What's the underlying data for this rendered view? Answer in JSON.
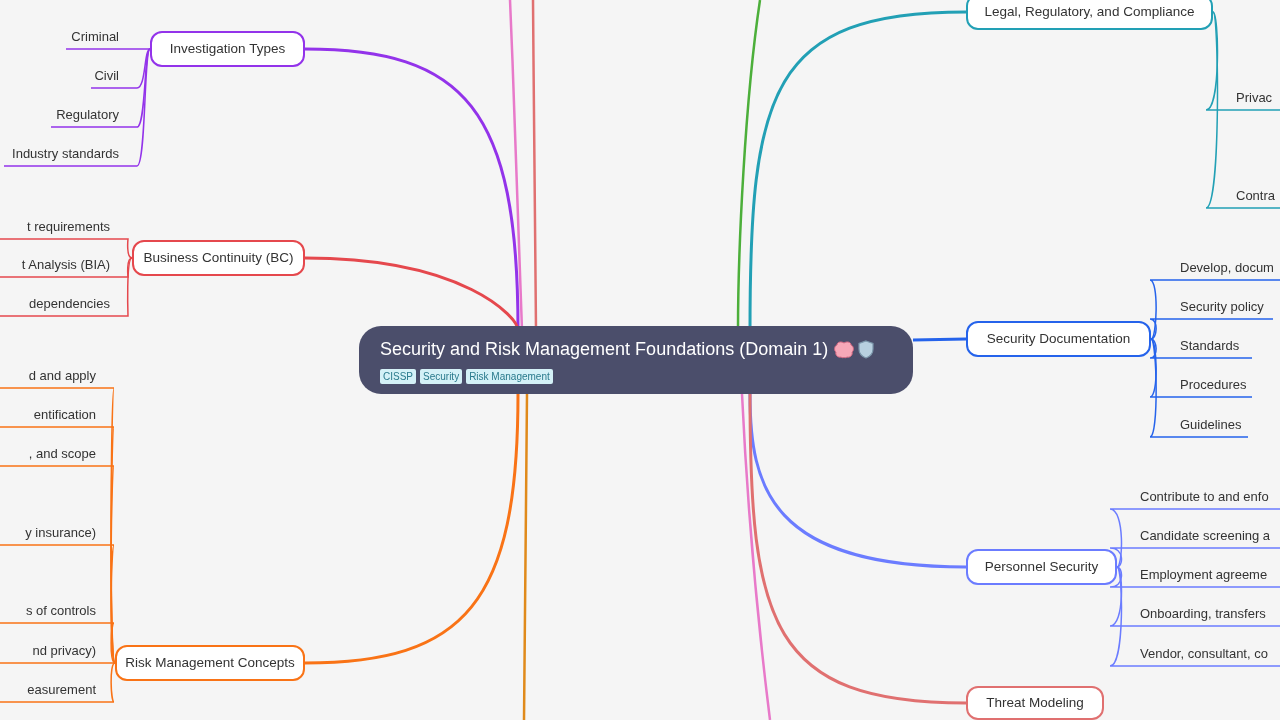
{
  "central": {
    "title": "Security and Risk Management Foundations (Domain 1)",
    "tags": [
      "CISSP",
      "Security",
      "Risk Management"
    ]
  },
  "branches": [
    {
      "label": "Investigation Types",
      "color": "#9333ea",
      "children": [
        {
          "label": "Criminal"
        },
        {
          "label": "Civil"
        },
        {
          "label": "Regulatory"
        },
        {
          "label": "Industry standards"
        }
      ]
    },
    {
      "label": "Business Continuity (BC)",
      "color": "#e5484d",
      "children": [
        {
          "label": "t requirements"
        },
        {
          "label": "t Analysis (BIA)"
        },
        {
          "label": "dependencies"
        }
      ]
    },
    {
      "label": "Risk Management Concepts",
      "color": "#f97316",
      "children": [
        {
          "label": "d and apply"
        },
        {
          "label": "entification"
        },
        {
          "label": ", and scope"
        },
        {
          "label": "y insurance)"
        },
        {
          "label": "s of controls"
        },
        {
          "label": "nd privacy)"
        },
        {
          "label": "easurement"
        }
      ]
    },
    {
      "label": "Legal, Regulatory, and Compliance",
      "color": "#22a0b5",
      "children": [
        {
          "label": "Privac"
        },
        {
          "label": "Contra"
        }
      ]
    },
    {
      "label": "Security Documentation",
      "color": "#2563eb",
      "children": [
        {
          "label": "Develop, docum"
        },
        {
          "label": "Security policy"
        },
        {
          "label": "Standards"
        },
        {
          "label": "Procedures"
        },
        {
          "label": "Guidelines"
        }
      ]
    },
    {
      "label": "Personnel Security",
      "color": "#6b7cff",
      "children": [
        {
          "label": "Contribute to and enfo"
        },
        {
          "label": "Candidate screening a"
        },
        {
          "label": "Employment agreeme"
        },
        {
          "label": "Onboarding, transfers"
        },
        {
          "label": "Vendor, consultant, co"
        }
      ]
    },
    {
      "label": "Threat Modeling",
      "color": "#e07070"
    }
  ]
}
